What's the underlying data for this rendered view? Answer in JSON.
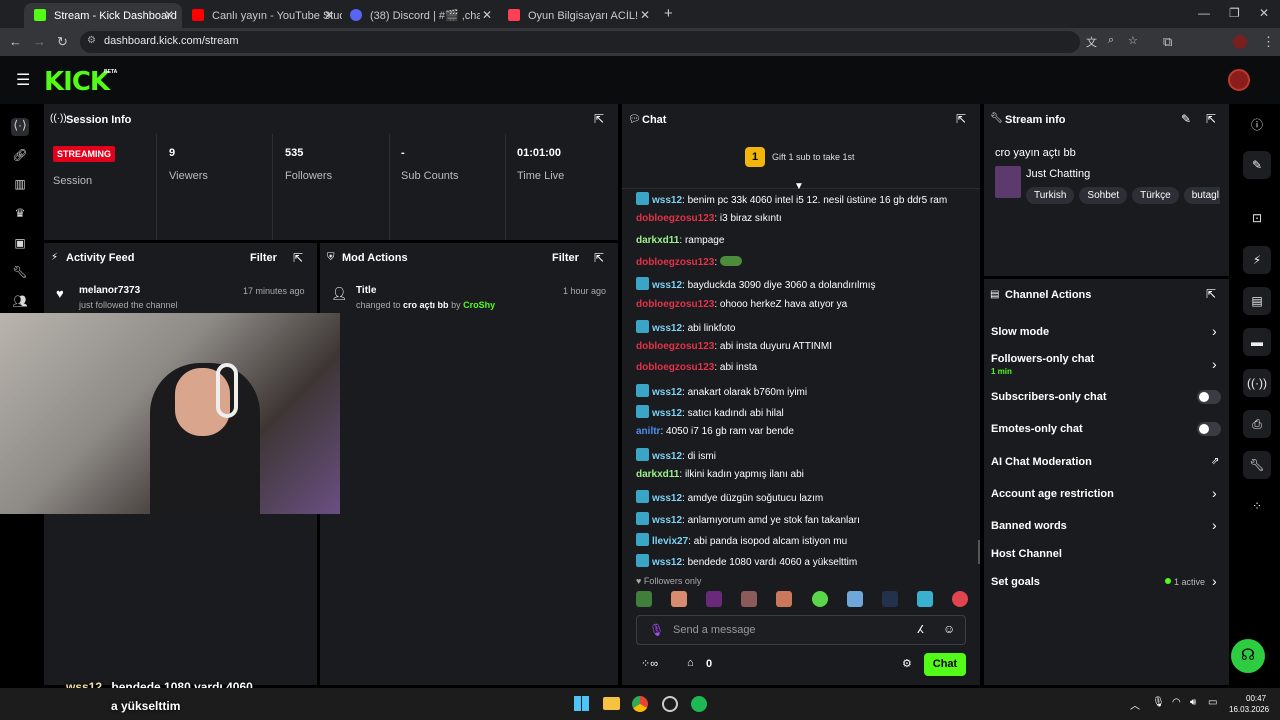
{
  "browser": {
    "tabs": [
      {
        "title": "Stream - Kick Dashboard",
        "color": "#53fc18"
      },
      {
        "title": "Canlı yayın - YouTube Studio",
        "color": "#ff0000"
      },
      {
        "title": "(38) Discord | #🎬 ,chat | CroS",
        "color": "#5865f2"
      },
      {
        "title": "Oyun Bilgisayarı ACİL!! - letgo",
        "color": "#ff3f55"
      }
    ],
    "url": "dashboard.kick.com/stream"
  },
  "kick": {
    "logo": "KICK",
    "beta": "BETA"
  },
  "session": {
    "title": "Session Info",
    "status": "STREAMING",
    "session_label": "Session",
    "stats": [
      {
        "value": "9",
        "label": "Viewers"
      },
      {
        "value": "535",
        "label": "Followers"
      },
      {
        "value": "-",
        "label": "Sub Counts"
      },
      {
        "value": "01:01:00",
        "label": "Time Live"
      }
    ]
  },
  "activity": {
    "title": "Activity Feed",
    "filter": "Filter",
    "item_user": "melanor7373",
    "item_text": "just followed the channel",
    "item_time": "17 minutes ago"
  },
  "mod": {
    "title": "Mod Actions",
    "filter": "Filter",
    "item_title": "Title",
    "item_pre": "changed to ",
    "item_value": "cro açtı bb",
    "item_by": " by ",
    "item_user": "CroShy",
    "item_time": "1 hour ago"
  },
  "chat": {
    "title": "Chat",
    "gift_rank": "1",
    "gift_text": "Gift 1 sub to take 1st",
    "messages": [
      {
        "user": "wss12",
        "text": "benim pc 33k 4060 intel i5 12. nesil üstüne 16 gb ddr5 ram",
        "color": "#7dd3f5",
        "badge": true
      },
      {
        "user": "dobloegzosu123",
        "text": "i3 biraz sıkıntı",
        "color": "#e3324a",
        "badge": false
      },
      {
        "user": "darkxd11",
        "text": "rampage",
        "color": "#9cf28a",
        "badge": false
      },
      {
        "user": "dobloegzosu123",
        "text": "",
        "color": "#e3324a",
        "badge": false
      },
      {
        "user": "wss12",
        "text": "bayduckda 3090 diye 3060 a dolandırılmış",
        "color": "#7dd3f5",
        "badge": true
      },
      {
        "user": "dobloegzosu123",
        "text": "ohooo herkeZ hava atıyor ya",
        "color": "#e3324a",
        "badge": false
      },
      {
        "user": "wss12",
        "text": "abi linkfoto",
        "color": "#7dd3f5",
        "badge": true
      },
      {
        "user": "dobloegzosu123",
        "text": "abi insta duyuru ATTINMI",
        "color": "#e3324a",
        "badge": false
      },
      {
        "user": "dobloegzosu123",
        "text": "abi insta",
        "color": "#e3324a",
        "badge": false
      },
      {
        "user": "wss12",
        "text": "anakart olarak b760m iyimi",
        "color": "#7dd3f5",
        "badge": true
      },
      {
        "user": "wss12",
        "text": "satıcı kadındı abi hilal",
        "color": "#7dd3f5",
        "badge": true
      },
      {
        "user": "aniltr",
        "text": "4050 i7 16 gb ram var bende",
        "color": "#4c8df0",
        "badge": false
      },
      {
        "user": "wss12",
        "text": "di ismi",
        "color": "#7dd3f5",
        "badge": true
      },
      {
        "user": "darkxd11",
        "text": "ilkini kadın yapmış ilanı abi",
        "color": "#9cf28a",
        "badge": false
      },
      {
        "user": "wss12",
        "text": "amdye düzgün soğutucu lazım",
        "color": "#7dd3f5",
        "badge": true
      },
      {
        "user": "wss12",
        "text": "anlamıyorum amd ye stok fan takanları",
        "color": "#7dd3f5",
        "badge": true
      },
      {
        "user": "llevix27",
        "text": "abi panda isopod alcam istiyon mu",
        "color": "#7dd3f5",
        "badge": true
      },
      {
        "user": "wss12",
        "text": "bendede 1080 vardı 4060 a yükselttim",
        "color": "#7dd3f5",
        "badge": true
      }
    ],
    "followers_only": "Followers only",
    "placeholder": "Send a message",
    "points": "0",
    "chat_button": "Chat"
  },
  "stream_info": {
    "title": "Stream info",
    "stream_title": "cro yayın açtı bb",
    "category": "Just Chatting",
    "tags": [
      "Turkish",
      "Sohbet",
      "Türkçe",
      "butagl"
    ]
  },
  "channel_actions": {
    "title": "Channel Actions",
    "items": [
      {
        "label": "Slow mode"
      },
      {
        "label": "Followers-only chat",
        "sub": "1 min"
      },
      {
        "label": "Subscribers-only chat"
      },
      {
        "label": "Emotes-only chat"
      },
      {
        "label": "AI Chat Moderation"
      },
      {
        "label": "Account age restriction"
      },
      {
        "label": "Banned words"
      },
      {
        "label": "Host Channel"
      },
      {
        "label": "Set goals",
        "status": "1 active"
      }
    ]
  },
  "overlay": {
    "user": "wss12",
    "text_line1": "bendede 1080 vardı 4060",
    "text_line2": "a yükselttim"
  },
  "taskbar": {
    "time": "00:47",
    "date": "16.03.2026"
  },
  "colors": {
    "accent": "#53fc18",
    "streaming": "#e3001b",
    "panel": "#191b1f"
  }
}
